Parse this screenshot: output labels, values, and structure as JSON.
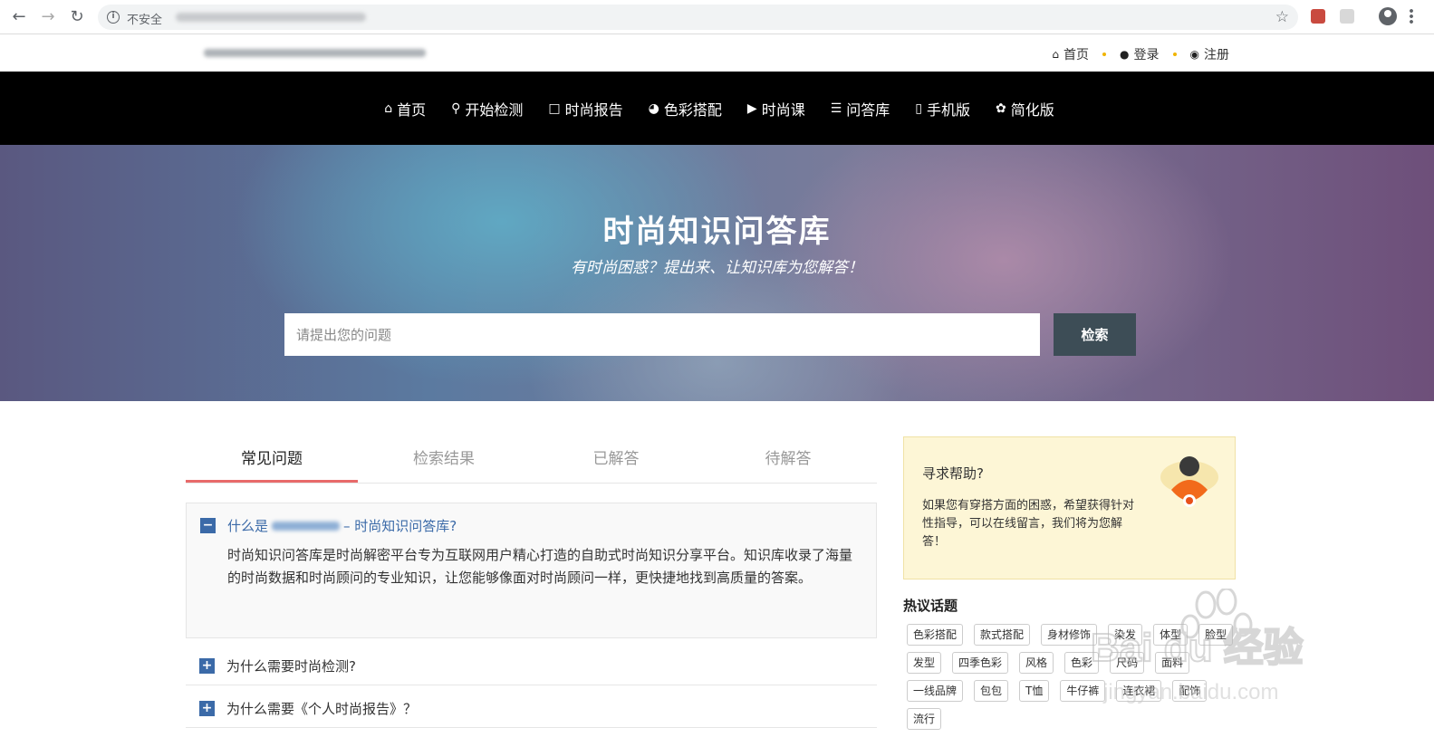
{
  "browser": {
    "security_label": "不安全"
  },
  "topbar": {
    "links": [
      {
        "label": "首页",
        "icon": "home-icon"
      },
      {
        "label": "登录",
        "icon": "user-icon"
      },
      {
        "label": "注册",
        "icon": "comments-icon"
      }
    ]
  },
  "nav": {
    "items": [
      {
        "label": "首页",
        "icon": "home-icon"
      },
      {
        "label": "开始检测",
        "icon": "search-icon"
      },
      {
        "label": "时尚报告",
        "icon": "folder-icon"
      },
      {
        "label": "色彩搭配",
        "icon": "pie-chart-icon"
      },
      {
        "label": "时尚课",
        "icon": "play-circle-icon"
      },
      {
        "label": "问答库",
        "icon": "database-icon"
      },
      {
        "label": "手机版",
        "icon": "mobile-icon"
      },
      {
        "label": "简化版",
        "icon": "paw-icon"
      }
    ]
  },
  "hero": {
    "title": "时尚知识问答库",
    "subtitle": "有时尚困惑？提出来、让知识库为您解答！",
    "search_placeholder": "请提出您的问题",
    "search_button": "检索"
  },
  "tabs": [
    "常见问题",
    "检索结果",
    "已解答",
    "待解答"
  ],
  "faq": {
    "open": {
      "question_prefix": "什么是",
      "question_suffix": "– 时尚知识问答库?",
      "answer": "时尚知识问答库是时尚解密平台专为互联网用户精心打造的自助式时尚知识分享平台。知识库收录了海量的时尚数据和时尚顾问的专业知识，让您能够像面对时尚顾问一样，更快捷地找到高质量的答案。"
    },
    "collapsed": [
      {
        "question": "为什么需要时尚检测?"
      },
      {
        "question": "为什么需要《个人时尚报告》？"
      }
    ]
  },
  "help": {
    "title": "寻求帮助?",
    "text": "如果您有穿搭方面的困惑，希望获得针对性指导，可以在线留言，我们将为您解答！"
  },
  "hot_topics": {
    "title": "热议话题",
    "tags": [
      "色彩搭配",
      "款式搭配",
      "身材修饰",
      "染发",
      "体型",
      "脸型",
      "发型",
      "四季色彩",
      "风格",
      "色彩",
      "尺码",
      "面料",
      "一线品牌",
      "包包",
      "T恤",
      "牛仔裤",
      "连衣裙",
      "配饰",
      "流行"
    ]
  },
  "watermark": {
    "brand": "Bai du 经验",
    "url": "jingyan.baidu.com"
  },
  "colors": {
    "nav_bg": "#000000",
    "accent_link": "#3b6aa8",
    "tab_underline": "#e86a6a",
    "search_button_bg": "#3d4d56",
    "help_bg": "#fdf6d6"
  }
}
